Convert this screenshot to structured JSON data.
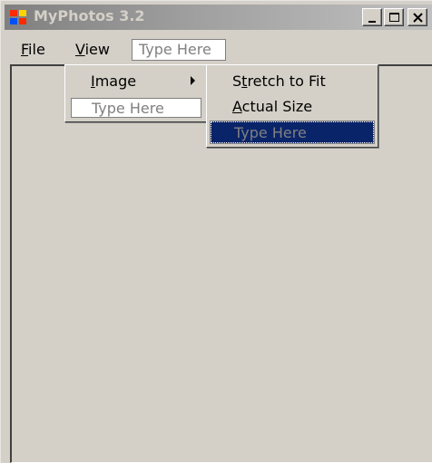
{
  "window": {
    "title": "MyPhotos 3.2",
    "icon": "windows-forms-app-icon"
  },
  "titlebar_buttons": [
    {
      "name": "minimize",
      "icon": "minimize-icon"
    },
    {
      "name": "maximize",
      "icon": "maximize-icon"
    },
    {
      "name": "close",
      "icon": "close-icon"
    }
  ],
  "menubar": {
    "file": {
      "accel": "F",
      "rest": "ile"
    },
    "view": {
      "accel": "V",
      "rest": "iew"
    },
    "type_here": "Type Here"
  },
  "view_menu": {
    "image": {
      "accel": "I",
      "rest": "mage"
    },
    "type_here": "Type Here"
  },
  "image_submenu": {
    "stretch": {
      "before": "S",
      "accel": "t",
      "rest": "retch to Fit"
    },
    "actual": {
      "accel": "A",
      "rest": "ctual Size"
    },
    "type_here": "Type Here"
  },
  "colors": {
    "face": "#d4d0c8",
    "title_gradient_start": "#808080",
    "highlight": "#0a246a",
    "placeholder_text": "#808080"
  }
}
